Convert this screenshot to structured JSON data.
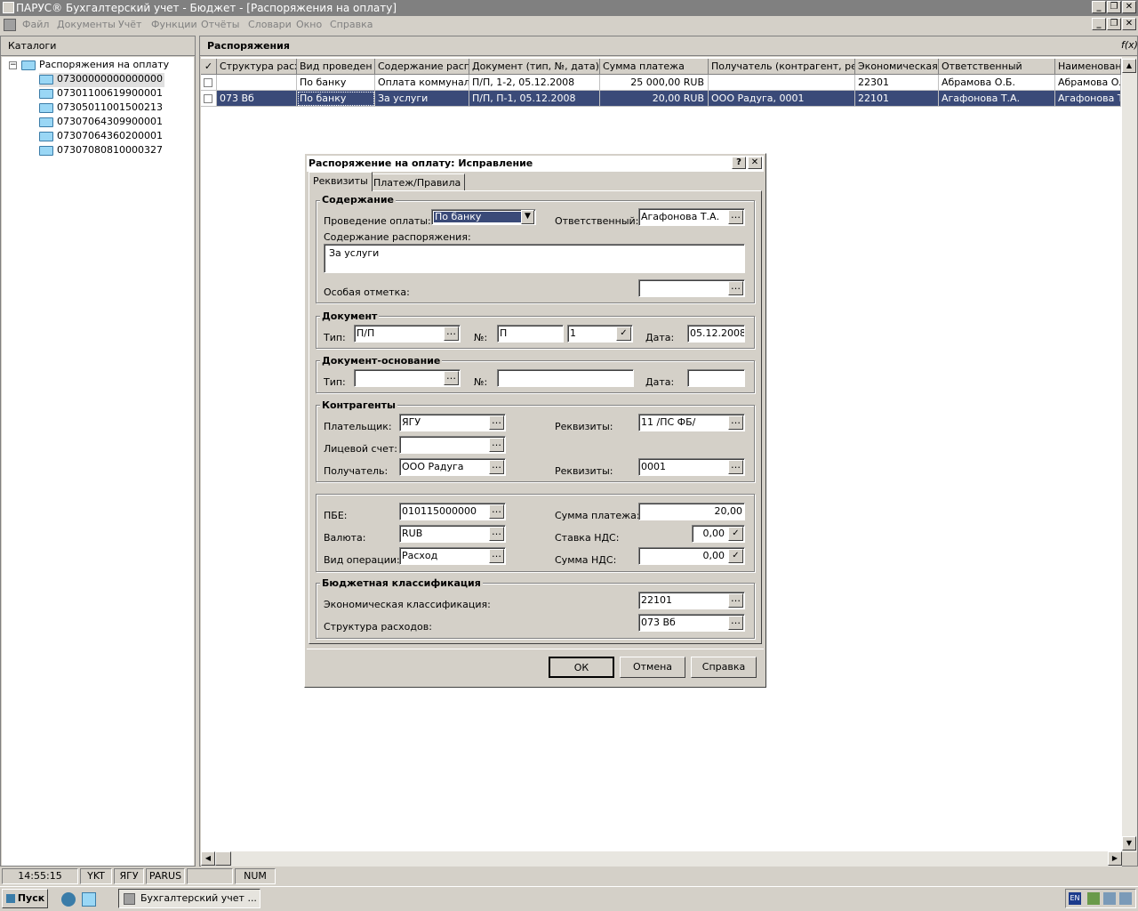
{
  "window": {
    "title": "ПАРУС® Бухгалтерский учет - Бюджет - [Распоряжения на оплату]"
  },
  "menu": [
    "Файл",
    "Документы",
    "Учёт",
    "Функции",
    "Отчёты",
    "Словари",
    "Окно",
    "Справка"
  ],
  "catalog": {
    "header": "Каталоги",
    "root": "Распоряжения на оплату",
    "items": [
      "07300000000000000",
      "07301100619900001",
      "07305011001500213",
      "07307064309900001",
      "07307064360200001",
      "07307080810000327"
    ]
  },
  "orders": {
    "header": "Распоряжения",
    "fx_icon": "f(x)",
    "columns": [
      "Структура расх",
      "Вид проведен",
      "Содержание распо",
      "Документ (тип, №, дата)",
      "Сумма платежа",
      "Получатель (контрагент, рекв",
      "Экономическая к",
      "Ответственный",
      "Наименование"
    ],
    "rows": [
      [
        "",
        "По банку",
        "Оплата коммуналь",
        "П/П, 1-2, 05.12.2008",
        "25 000,00 RUB",
        "",
        "22301",
        "Абрамова О.Б.",
        "Абрамова Оль"
      ],
      [
        "073 Вб",
        "По банку",
        "За услуги",
        "П/П, П-1, 05.12.2008",
        "20,00 RUB",
        "ООО Радуга, 0001",
        "22101",
        "Агафонова Т.А.",
        "Агафонова Та"
      ]
    ]
  },
  "dialog": {
    "title": "Распоряжение на оплату: Исправление",
    "tabs": [
      "Реквизиты",
      "Платеж/Правила"
    ],
    "content": {
      "legend": "Содержание",
      "payment_label": "Проведение оплаты:",
      "payment_value": "По банку",
      "responsible_label": "Ответственный:",
      "responsible_value": "Агафонова Т.А.",
      "order_text_label": "Содержание распоряжения:",
      "order_text_value": "За услуги",
      "special_label": "Особая отметка:",
      "special_value": ""
    },
    "document": {
      "legend": "Документ",
      "type_label": "Тип:",
      "type_value": "П/П",
      "no_label": "№:",
      "prefix_value": "П",
      "number_value": "1",
      "date_label": "Дата:",
      "date_value": "05.12.2008"
    },
    "basis": {
      "legend": "Документ-основание",
      "type_label": "Тип:",
      "no_label": "№:",
      "date_label": "Дата:"
    },
    "contractors": {
      "legend": "Контрагенты",
      "payer_label": "Плательщик:",
      "payer_value": "ЯГУ",
      "payer_req_label": "Реквизиты:",
      "payer_req_value": "11 /ПС ФБ/",
      "account_label": "Лицевой счет:",
      "account_value": "",
      "recipient_label": "Получатель:",
      "recipient_value": "ООО Радуга",
      "recipient_req_label": "Реквизиты:",
      "recipient_req_value": "0001"
    },
    "payment": {
      "pbe_label": "ПБЕ:",
      "pbe_value": "010115000000",
      "currency_label": "Валюта:",
      "currency_value": "RUB",
      "operation_label": "Вид операции:",
      "operation_value": "Расход",
      "sum_label": "Сумма платежа:",
      "sum_value": "20,00",
      "vat_rate_label": "Ставка НДС:",
      "vat_rate_value": "0,00",
      "vat_sum_label": "Сумма НДС:",
      "vat_sum_value": "0,00"
    },
    "budget": {
      "legend": "Бюджетная классификация",
      "econ_label": "Экономическая классификация:",
      "econ_value": "22101",
      "struct_label": "Структура расходов:",
      "struct_value": "073 Вб"
    },
    "buttons": {
      "ok": "ОК",
      "cancel": "Отмена",
      "help": "Справка"
    }
  },
  "status": [
    "14:55:15",
    "YKT",
    "ЯГУ",
    "PARUS",
    "",
    "NUM"
  ],
  "taskbar": {
    "start": "Пуск",
    "task": "Бухгалтерский учет ...",
    "lang": "EN"
  }
}
